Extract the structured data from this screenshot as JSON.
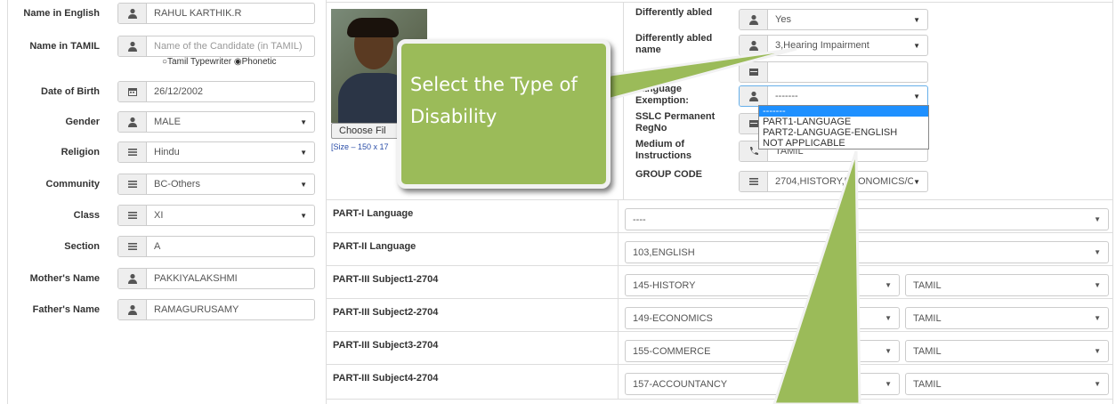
{
  "left_form": [
    {
      "label": "Name in English",
      "icon": "user-icon",
      "value": "RAHUL KARTHIK.R",
      "placeholder": false,
      "select": false
    },
    {
      "label": "Name in TAMIL",
      "icon": "user-icon",
      "value": "Name of the Candidate (in TAMIL)",
      "placeholder": true,
      "select": false
    },
    {
      "label": "Date of Birth",
      "icon": "calendar-icon",
      "value": "26/12/2002",
      "placeholder": false,
      "select": false
    },
    {
      "label": "Gender",
      "icon": "user-icon",
      "value": "MALE",
      "placeholder": false,
      "select": true
    },
    {
      "label": "Religion",
      "icon": "list-icon",
      "value": "Hindu",
      "placeholder": false,
      "select": true
    },
    {
      "label": "Community",
      "icon": "list-icon",
      "value": "BC-Others",
      "placeholder": false,
      "select": true
    },
    {
      "label": "Class",
      "icon": "list-icon",
      "value": "XI",
      "placeholder": false,
      "select": true
    },
    {
      "label": "Section",
      "icon": "list-icon",
      "value": "A",
      "placeholder": false,
      "select": false
    },
    {
      "label": "Mother's Name",
      "icon": "user-icon",
      "value": "PAKKIYALAKSHMI",
      "placeholder": false,
      "select": false
    },
    {
      "label": "Father's Name",
      "icon": "user-icon",
      "value": "RAMAGURUSAMY",
      "placeholder": false,
      "select": false
    }
  ],
  "tamil_input": {
    "opt1": "Tamil Typewriter",
    "opt2": "Phonetic",
    "selected": "Phonetic"
  },
  "photo": {
    "choose_file": "Choose Fil",
    "size_note": "[Size – 150 x 17"
  },
  "right_form": [
    {
      "label": "Differently abled",
      "icon": "user-icon",
      "value": "Yes",
      "select": true
    },
    {
      "label": "Differently abled name",
      "icon": "user-icon",
      "value": "3,Hearing Impairment",
      "select": true
    },
    {
      "label": "",
      "icon": "id-card-icon",
      "value": "",
      "select": false
    },
    {
      "label": "Language Exemption:",
      "icon": "user-icon",
      "value": "-------",
      "select": true
    },
    {
      "label": "SSLC Permanent RegNo",
      "icon": "id-card-icon",
      "value": "",
      "select": false
    },
    {
      "label": "Medium of Instructions",
      "icon": "phone-icon",
      "value": "TAMIL",
      "select": false
    },
    {
      "label": "GROUP CODE",
      "icon": "list-icon",
      "value": "2704,HISTORY,ECONOMICS/CC",
      "select": true
    }
  ],
  "dropdown_options": [
    "-------",
    "PART1-LANGUAGE",
    "PART2-LANGUAGE-ENGLISH",
    "NOT APPLICABLE"
  ],
  "subjects": [
    {
      "label": "PART-I Language",
      "value": "----",
      "medium": ""
    },
    {
      "label": "PART-II Language",
      "value": "103,ENGLISH",
      "medium": ""
    },
    {
      "label": "PART-III Subject1-2704",
      "value": "145-HISTORY",
      "medium": "TAMIL"
    },
    {
      "label": "PART-III Subject2-2704",
      "value": "149-ECONOMICS",
      "medium": "TAMIL"
    },
    {
      "label": "PART-III Subject3-2704",
      "value": "155-COMMERCE",
      "medium": "TAMIL"
    },
    {
      "label": "PART-III Subject4-2704",
      "value": "157-ACCOUNTANCY",
      "medium": "TAMIL"
    }
  ],
  "callout": {
    "text": "Select the Type of Disability"
  },
  "colors": {
    "callout": "#9bbb59",
    "highlight": "#1e90ff"
  }
}
